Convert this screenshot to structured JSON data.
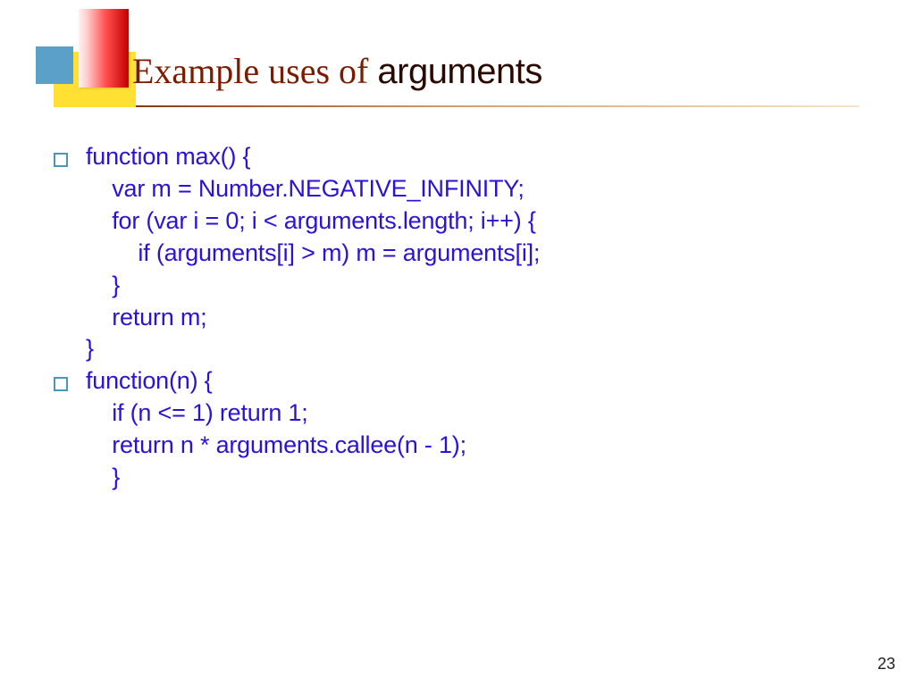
{
  "title": {
    "prefix": "Example uses of ",
    "keyword": "arguments"
  },
  "bullets": [
    {
      "lines": [
        "function max() {",
        "    var m = Number.NEGATIVE_INFINITY;",
        "    for (var i = 0; i < arguments.length; i++) {",
        "        if (arguments[i] > m) m = arguments[i];",
        "    }",
        "    return m;",
        "}"
      ]
    },
    {
      "lines": [
        "function(n) {",
        "    if (n <= 1) return 1;",
        "    return n * arguments.callee(n - 1);",
        "    }"
      ]
    }
  ],
  "pageNumber": "23"
}
